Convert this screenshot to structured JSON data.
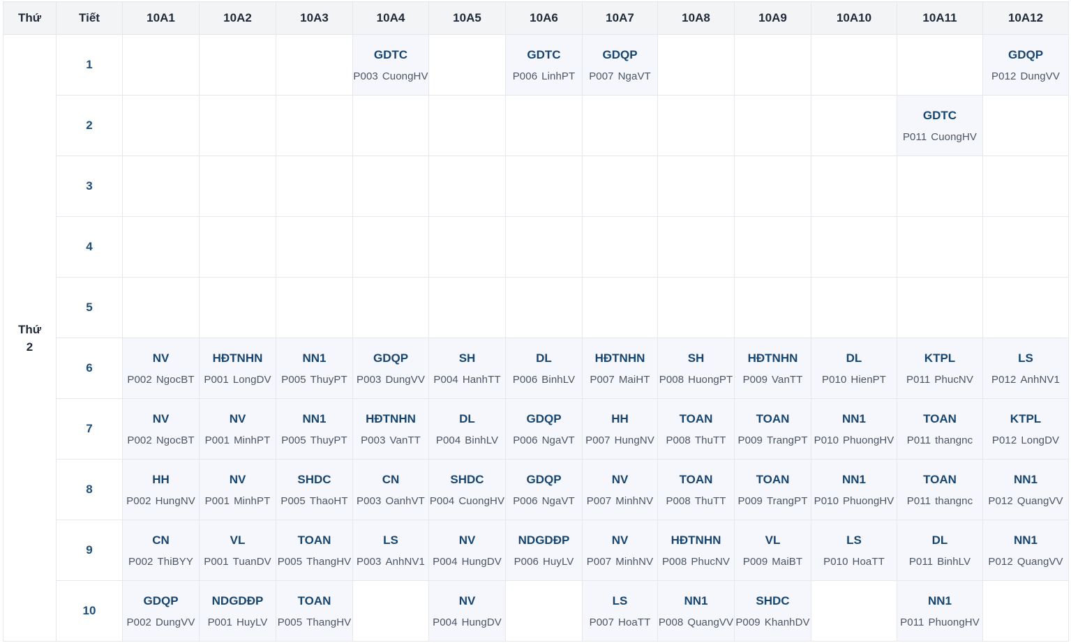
{
  "header": {
    "day_col": "Thứ",
    "period_col": "Tiết",
    "classes": [
      "10A1",
      "10A2",
      "10A3",
      "10A4",
      "10A5",
      "10A6",
      "10A7",
      "10A8",
      "10A9",
      "10A10",
      "10A11",
      "10A12"
    ]
  },
  "day_label": "Thứ 2",
  "rows": [
    {
      "period": "1",
      "cells": [
        null,
        null,
        null,
        {
          "subject": "GDTC",
          "room": "P003",
          "teacher": "CuongHV"
        },
        null,
        {
          "subject": "GDTC",
          "room": "P006",
          "teacher": "LinhPT"
        },
        {
          "subject": "GDQP",
          "room": "P007",
          "teacher": "NgaVT"
        },
        null,
        null,
        null,
        null,
        {
          "subject": "GDQP",
          "room": "P012",
          "teacher": "DungVV"
        }
      ]
    },
    {
      "period": "2",
      "cells": [
        null,
        null,
        null,
        null,
        null,
        null,
        null,
        null,
        null,
        null,
        {
          "subject": "GDTC",
          "room": "P011",
          "teacher": "CuongHV"
        },
        null
      ]
    },
    {
      "period": "3",
      "cells": [
        null,
        null,
        null,
        null,
        null,
        null,
        null,
        null,
        null,
        null,
        null,
        null
      ]
    },
    {
      "period": "4",
      "cells": [
        null,
        null,
        null,
        null,
        null,
        null,
        null,
        null,
        null,
        null,
        null,
        null
      ]
    },
    {
      "period": "5",
      "cells": [
        null,
        null,
        null,
        null,
        null,
        null,
        null,
        null,
        null,
        null,
        null,
        null
      ]
    },
    {
      "period": "6",
      "cells": [
        {
          "subject": "NV",
          "room": "P002",
          "teacher": "NgocBT"
        },
        {
          "subject": "HĐTNHN",
          "room": "P001",
          "teacher": "LongDV"
        },
        {
          "subject": "NN1",
          "room": "P005",
          "teacher": "ThuyPT"
        },
        {
          "subject": "GDQP",
          "room": "P003",
          "teacher": "DungVV"
        },
        {
          "subject": "SH",
          "room": "P004",
          "teacher": "HanhTT"
        },
        {
          "subject": "DL",
          "room": "P006",
          "teacher": "BinhLV"
        },
        {
          "subject": "HĐTNHN",
          "room": "P007",
          "teacher": "MaiHT"
        },
        {
          "subject": "SH",
          "room": "P008",
          "teacher": "HuongPT"
        },
        {
          "subject": "HĐTNHN",
          "room": "P009",
          "teacher": "VanTT"
        },
        {
          "subject": "DL",
          "room": "P010",
          "teacher": "HienPT"
        },
        {
          "subject": "KTPL",
          "room": "P011",
          "teacher": "PhucNV"
        },
        {
          "subject": "LS",
          "room": "P012",
          "teacher": "AnhNV1"
        }
      ]
    },
    {
      "period": "7",
      "cells": [
        {
          "subject": "NV",
          "room": "P002",
          "teacher": "NgocBT"
        },
        {
          "subject": "NV",
          "room": "P001",
          "teacher": "MinhPT"
        },
        {
          "subject": "NN1",
          "room": "P005",
          "teacher": "ThuyPT"
        },
        {
          "subject": "HĐTNHN",
          "room": "P003",
          "teacher": "VanTT"
        },
        {
          "subject": "DL",
          "room": "P004",
          "teacher": "BinhLV"
        },
        {
          "subject": "GDQP",
          "room": "P006",
          "teacher": "NgaVT"
        },
        {
          "subject": "HH",
          "room": "P007",
          "teacher": "HungNV"
        },
        {
          "subject": "TOAN",
          "room": "P008",
          "teacher": "ThuTT"
        },
        {
          "subject": "TOAN",
          "room": "P009",
          "teacher": "TrangPT"
        },
        {
          "subject": "NN1",
          "room": "P010",
          "teacher": "PhuongHV"
        },
        {
          "subject": "TOAN",
          "room": "P011",
          "teacher": "thangnc"
        },
        {
          "subject": "KTPL",
          "room": "P012",
          "teacher": "LongDV"
        }
      ]
    },
    {
      "period": "8",
      "cells": [
        {
          "subject": "HH",
          "room": "P002",
          "teacher": "HungNV"
        },
        {
          "subject": "NV",
          "room": "P001",
          "teacher": "MinhPT"
        },
        {
          "subject": "SHDC",
          "room": "P005",
          "teacher": "ThaoHT"
        },
        {
          "subject": "CN",
          "room": "P003",
          "teacher": "OanhVT"
        },
        {
          "subject": "SHDC",
          "room": "P004",
          "teacher": "CuongHV"
        },
        {
          "subject": "GDQP",
          "room": "P006",
          "teacher": "NgaVT"
        },
        {
          "subject": "NV",
          "room": "P007",
          "teacher": "MinhNV"
        },
        {
          "subject": "TOAN",
          "room": "P008",
          "teacher": "ThuTT"
        },
        {
          "subject": "TOAN",
          "room": "P009",
          "teacher": "TrangPT"
        },
        {
          "subject": "NN1",
          "room": "P010",
          "teacher": "PhuongHV"
        },
        {
          "subject": "TOAN",
          "room": "P011",
          "teacher": "thangnc"
        },
        {
          "subject": "NN1",
          "room": "P012",
          "teacher": "QuangVV"
        }
      ]
    },
    {
      "period": "9",
      "cells": [
        {
          "subject": "CN",
          "room": "P002",
          "teacher": "ThiBYY"
        },
        {
          "subject": "VL",
          "room": "P001",
          "teacher": "TuanDV"
        },
        {
          "subject": "TOAN",
          "room": "P005",
          "teacher": "ThangHV"
        },
        {
          "subject": "LS",
          "room": "P003",
          "teacher": "AnhNV1"
        },
        {
          "subject": "NV",
          "room": "P004",
          "teacher": "HungDV"
        },
        {
          "subject": "NDGDĐP",
          "room": "P006",
          "teacher": "HuyLV"
        },
        {
          "subject": "NV",
          "room": "P007",
          "teacher": "MinhNV"
        },
        {
          "subject": "HĐTNHN",
          "room": "P008",
          "teacher": "PhucNV"
        },
        {
          "subject": "VL",
          "room": "P009",
          "teacher": "MaiBT"
        },
        {
          "subject": "LS",
          "room": "P010",
          "teacher": "HoaTT"
        },
        {
          "subject": "DL",
          "room": "P011",
          "teacher": "BinhLV"
        },
        {
          "subject": "NN1",
          "room": "P012",
          "teacher": "QuangVV"
        }
      ]
    },
    {
      "period": "10",
      "cells": [
        {
          "subject": "GDQP",
          "room": "P002",
          "teacher": "DungVV"
        },
        {
          "subject": "NDGDĐP",
          "room": "P001",
          "teacher": "HuyLV"
        },
        {
          "subject": "TOAN",
          "room": "P005",
          "teacher": "ThangHV"
        },
        null,
        {
          "subject": "NV",
          "room": "P004",
          "teacher": "HungDV"
        },
        null,
        {
          "subject": "LS",
          "room": "P007",
          "teacher": "HoaTT"
        },
        {
          "subject": "NN1",
          "room": "P008",
          "teacher": "QuangVV"
        },
        {
          "subject": "SHDC",
          "room": "P009",
          "teacher": "KhanhDV"
        },
        null,
        {
          "subject": "NN1",
          "room": "P011",
          "teacher": "PhuongHV"
        },
        null
      ]
    }
  ]
}
